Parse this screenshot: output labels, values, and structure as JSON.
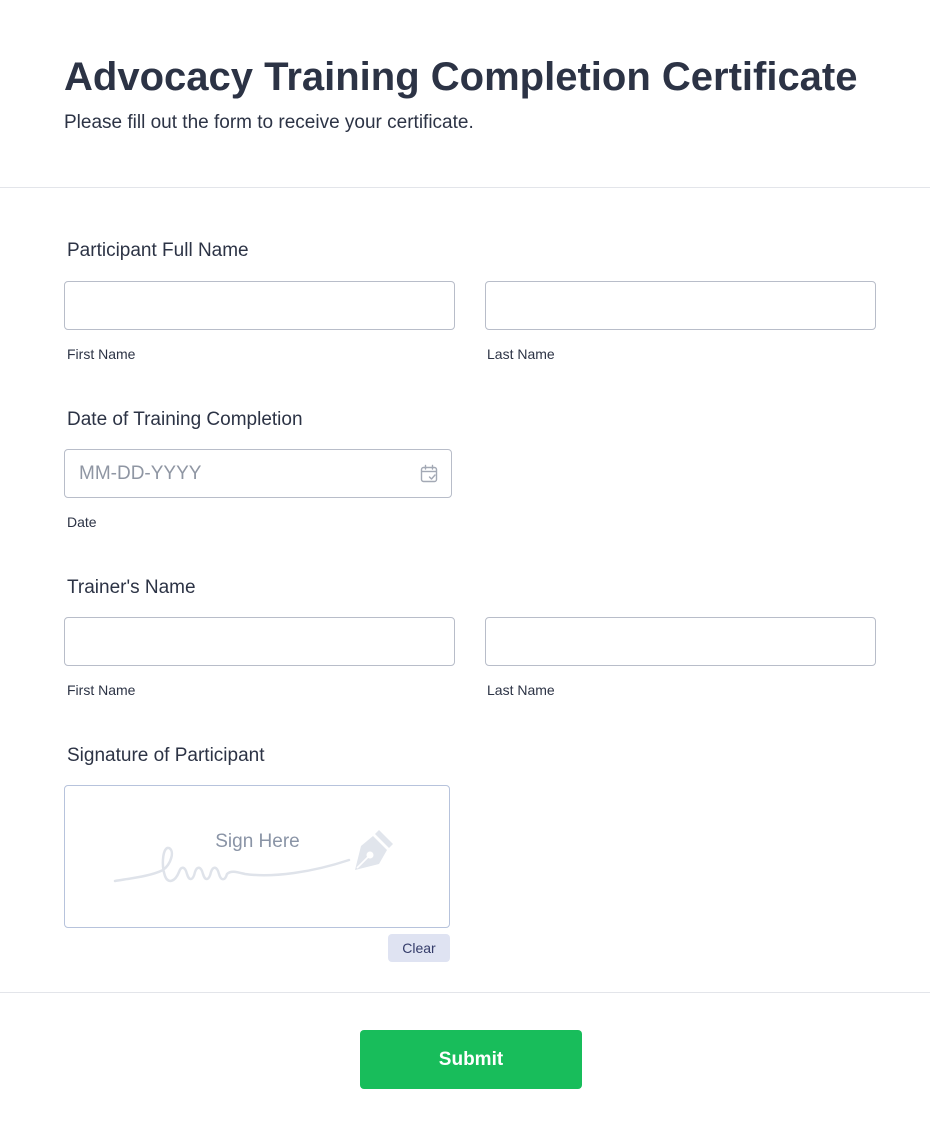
{
  "header": {
    "title": "Advocacy Training Completion Certificate",
    "subtitle": "Please fill out the form to receive your certificate."
  },
  "participant_name": {
    "label": "Participant Full Name",
    "first_sublabel": "First Name",
    "last_sublabel": "Last Name",
    "first_value": "",
    "last_value": ""
  },
  "completion_date": {
    "label": "Date of Training Completion",
    "placeholder": "MM-DD-YYYY",
    "value": "",
    "sublabel": "Date",
    "icon": "calendar-icon"
  },
  "trainer_name": {
    "label": "Trainer's Name",
    "first_sublabel": "First Name",
    "last_sublabel": "Last Name",
    "first_value": "",
    "last_value": ""
  },
  "signature": {
    "label": "Signature of Participant",
    "placeholder": "Sign Here",
    "clear_label": "Clear",
    "icon": "pen-nib-icon"
  },
  "submit": {
    "label": "Submit"
  },
  "colors": {
    "text": "#2c3345",
    "submit_bg": "#18bd5b",
    "input_border": "#b8bdc9",
    "clear_bg": "#dfe3f2"
  }
}
